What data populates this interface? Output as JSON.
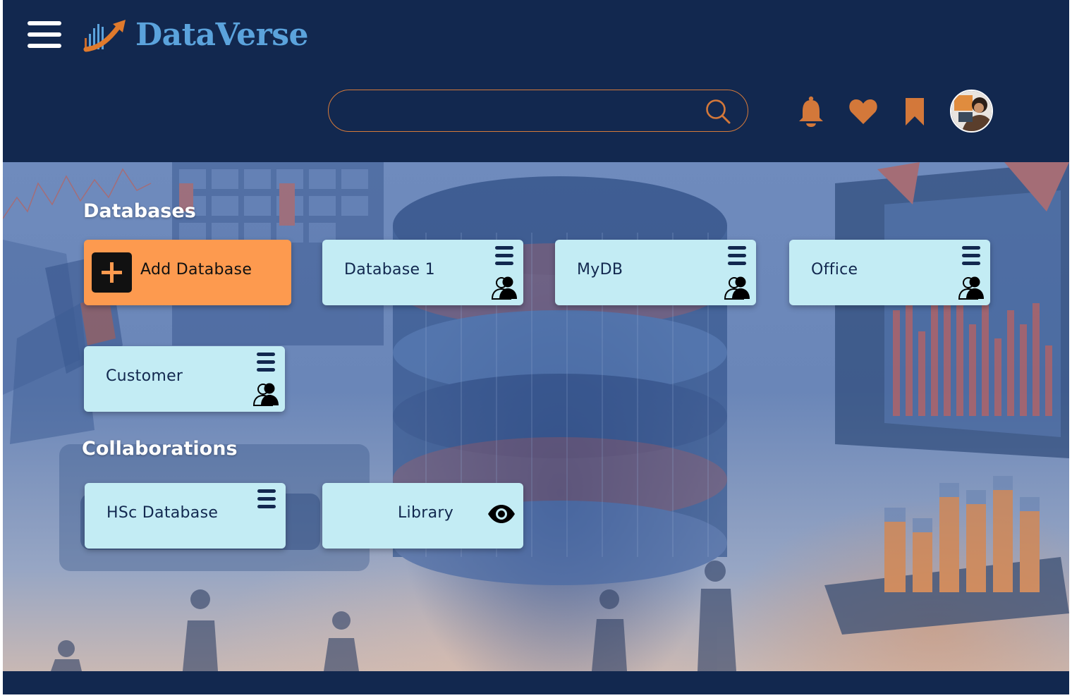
{
  "app": {
    "name": "DataVerse"
  },
  "header": {
    "menu_icon": "hamburger-menu-icon",
    "logo_icon": "growth-chart-logo-icon",
    "search": {
      "placeholder": "",
      "value": "",
      "icon": "search-icon"
    },
    "actions": [
      {
        "id": "notifications",
        "icon": "bell-icon"
      },
      {
        "id": "favorites",
        "icon": "heart-icon"
      },
      {
        "id": "bookmarks",
        "icon": "bookmark-icon"
      },
      {
        "id": "profile",
        "icon": "avatar"
      }
    ]
  },
  "databases": {
    "title": "Databases",
    "add_label": "Add Database",
    "items": [
      {
        "name": "Database 1",
        "icons": [
          "menu-icon",
          "share-users-icon"
        ]
      },
      {
        "name": "MyDB",
        "icons": [
          "menu-icon",
          "share-users-icon"
        ]
      },
      {
        "name": "Office",
        "icons": [
          "menu-icon",
          "share-users-icon"
        ]
      },
      {
        "name": "Customer",
        "icons": [
          "menu-icon",
          "share-users-icon"
        ]
      }
    ]
  },
  "collaborations": {
    "title": "Collaborations",
    "items": [
      {
        "name": "HSc Database",
        "icons": [
          "menu-icon"
        ]
      },
      {
        "name": "Library",
        "icons": [
          "eye-icon"
        ]
      }
    ]
  },
  "colors": {
    "navy": "#12284f",
    "accent_orange": "#fd9a4f",
    "icon_orange": "#d3783a",
    "card_bg": "#c3ecf4",
    "logo_blue": "#5ba3dc"
  }
}
